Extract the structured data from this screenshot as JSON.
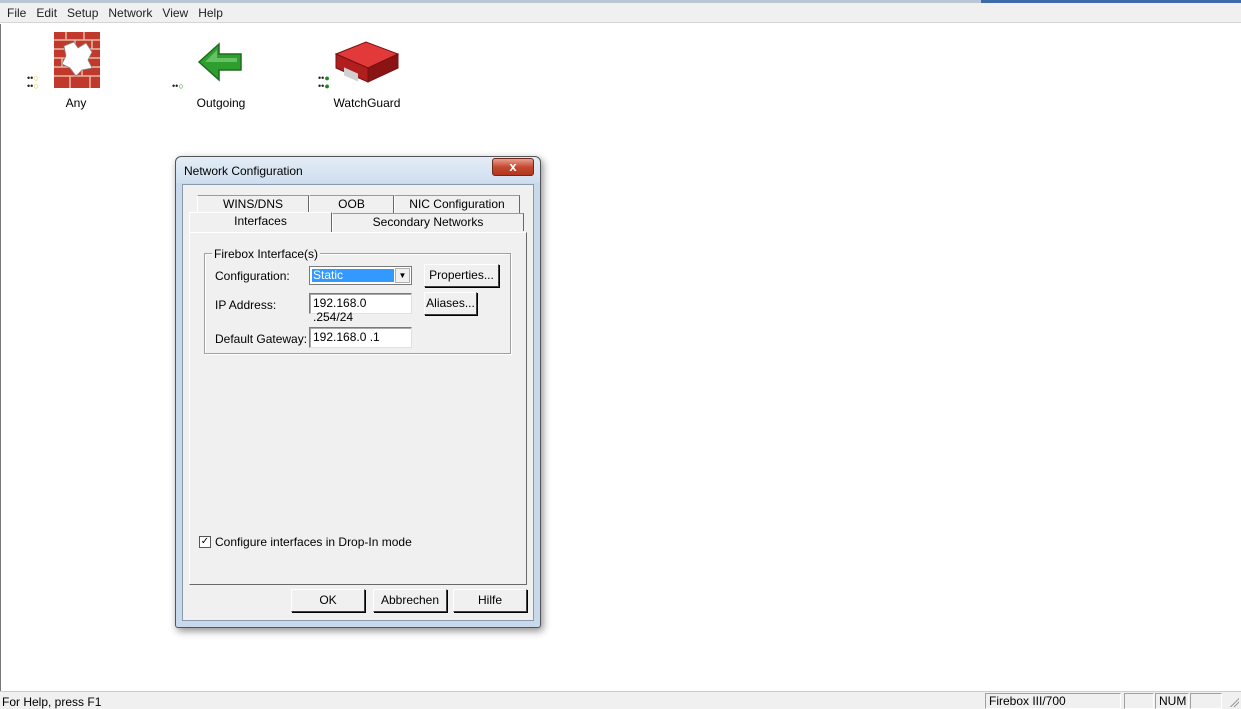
{
  "menubar": {
    "items": [
      "File",
      "Edit",
      "Setup",
      "Network",
      "View",
      "Help"
    ]
  },
  "services": [
    {
      "label": "Any",
      "icon": "firewall-brick-icon"
    },
    {
      "label": "Outgoing",
      "icon": "green-arrow-left-icon"
    },
    {
      "label": "WatchGuard",
      "icon": "red-router-icon"
    }
  ],
  "dialog": {
    "title": "Network Configuration",
    "close_label": "x",
    "tabs_back": [
      "WINS/DNS",
      "OOB",
      "NIC Configuration"
    ],
    "tabs_front": [
      "Interfaces",
      "Secondary Networks"
    ],
    "active_tab": "Interfaces",
    "group_title": "Firebox Interface(s)",
    "configuration_label": "Configuration:",
    "configuration_value": "Static",
    "properties_button": "Properties...",
    "ip_label": "IP Address:",
    "ip_value": "192.168.0  .254/24",
    "aliases_button": "Aliases...",
    "gateway_label": "Default Gateway:",
    "gateway_value": "192.168.0  .1",
    "dropin_label": "Configure interfaces in Drop-In mode",
    "dropin_checked": true,
    "ok_button": "OK",
    "cancel_button": "Abbrechen",
    "help_button": "Hilfe"
  },
  "statusbar": {
    "help_text": "For Help, press F1",
    "model": "Firebox III/700",
    "num": "NUM"
  },
  "colors": {
    "selection": "#3399ff",
    "close_button": "#c54a31",
    "dialog_frame": "#c9d9ec"
  }
}
